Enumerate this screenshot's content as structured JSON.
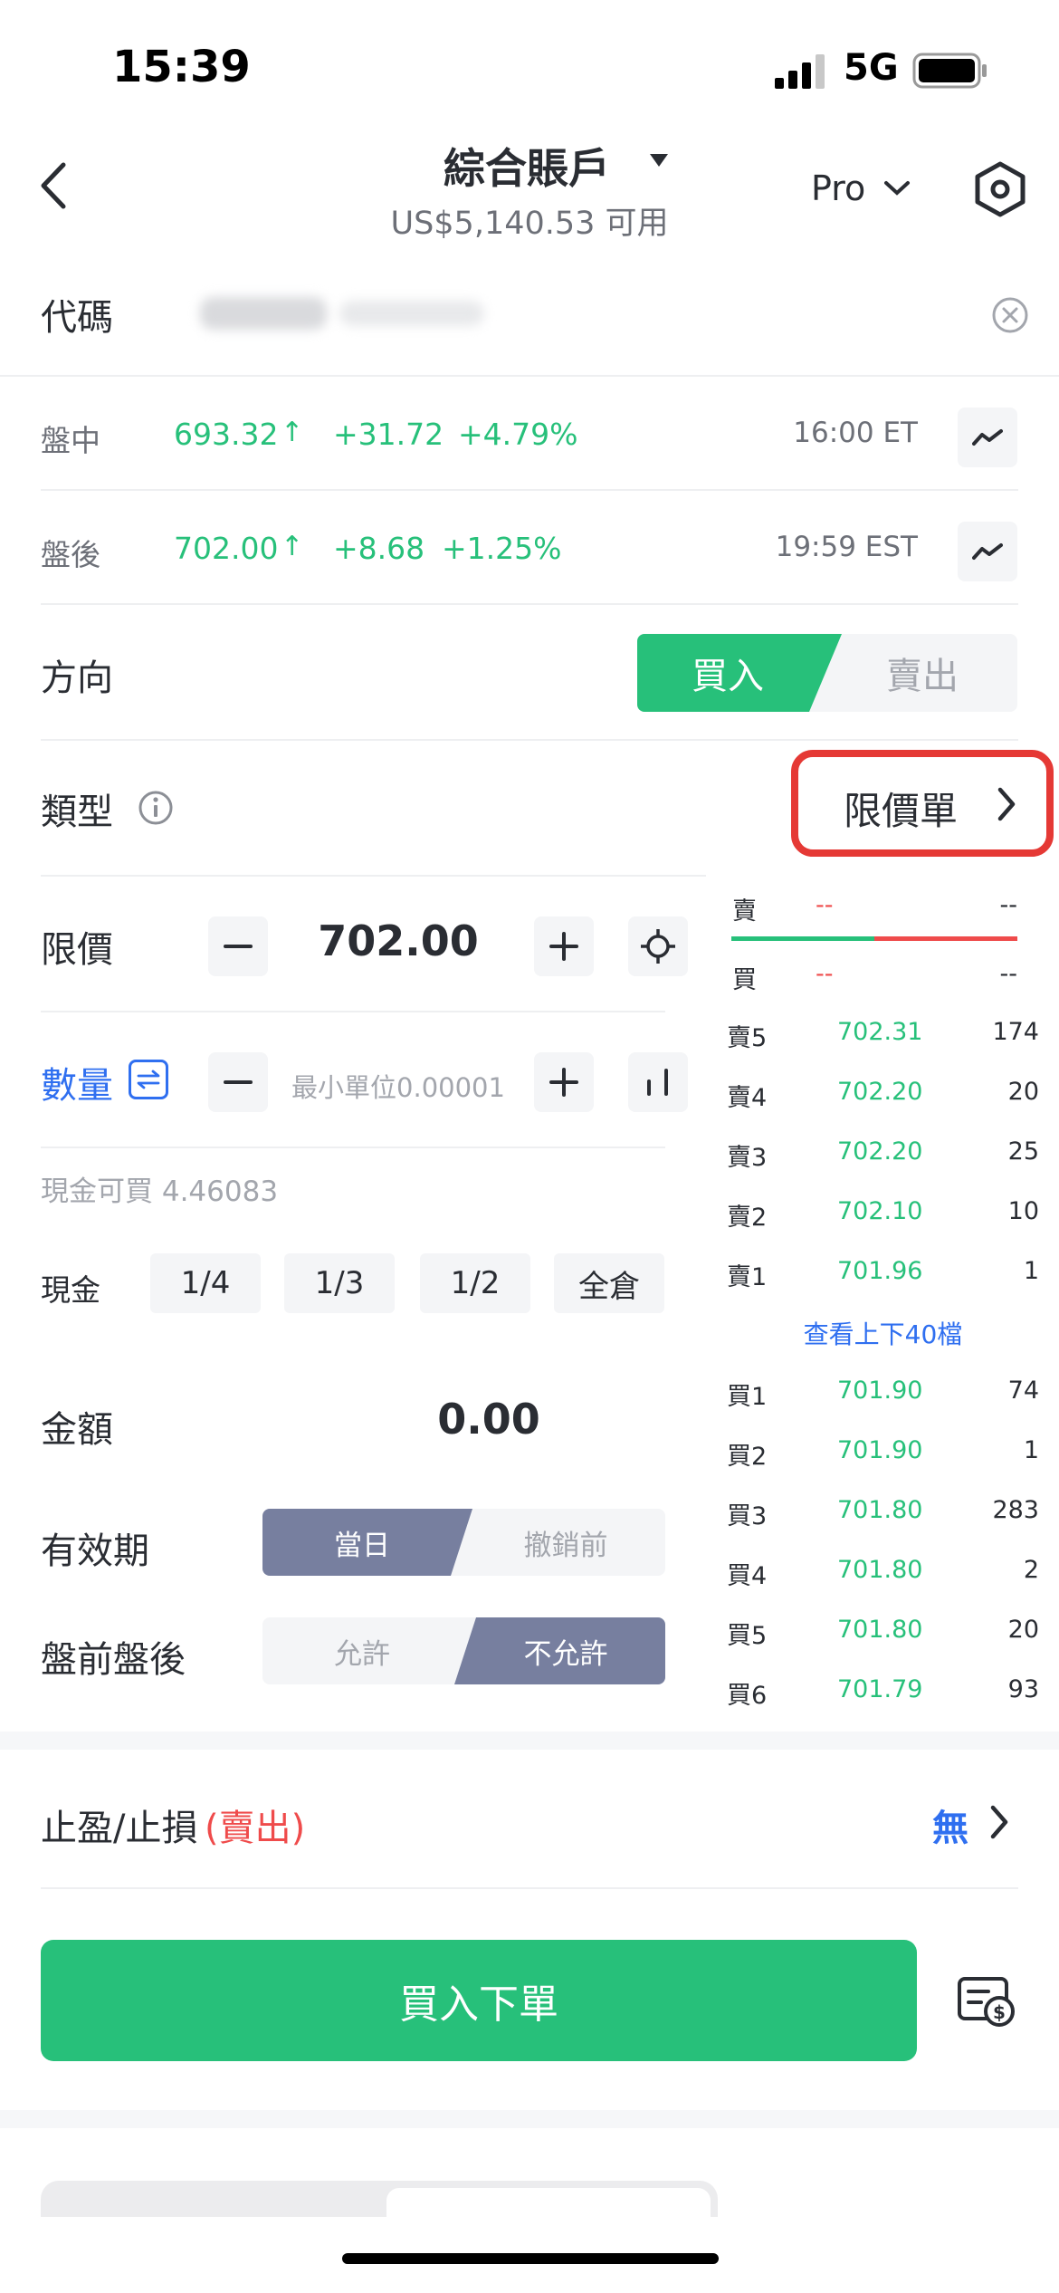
{
  "status_bar": {
    "time": "15:39",
    "network": "5G"
  },
  "header": {
    "title": "綜合賬戶",
    "subtitle": "US$5,140.53 可用",
    "pro_label": "Pro"
  },
  "code_row": {
    "label": "代碼"
  },
  "quotes": [
    {
      "label": "盤中",
      "price": "693.32",
      "arrow": "↑",
      "change": "+31.72",
      "percent": "+4.79%",
      "time": "16:00 ET"
    },
    {
      "label": "盤後",
      "price": "702.00",
      "arrow": "↑",
      "change": "+8.68",
      "percent": "+1.25%",
      "time": "19:59 EST"
    }
  ],
  "direction": {
    "label": "方向",
    "buy": "買入",
    "sell": "賣出"
  },
  "type": {
    "label": "類型",
    "value": "限價單"
  },
  "limit": {
    "label": "限價",
    "value": "702.00"
  },
  "quantity": {
    "label": "數量",
    "placeholder": "最小單位0.00001"
  },
  "cash_available": "現金可買 4.46083",
  "cash_row": {
    "label": "現金",
    "options": [
      "1/4",
      "1/3",
      "1/2",
      "全倉"
    ]
  },
  "amount": {
    "label": "金額",
    "value": "0.00"
  },
  "validity": {
    "label": "有效期",
    "left": "當日",
    "right": "撤銷前"
  },
  "extended": {
    "label": "盤前盤後",
    "left": "允許",
    "right": "不允許"
  },
  "order_book": {
    "sell_header": {
      "label": "賣",
      "price": "--",
      "qty": "--"
    },
    "buy_header": {
      "label": "買",
      "price": "--",
      "qty": "--"
    },
    "asks": [
      {
        "label": "賣5",
        "price": "702.31",
        "qty": "174"
      },
      {
        "label": "賣4",
        "price": "702.20",
        "qty": "20"
      },
      {
        "label": "賣3",
        "price": "702.20",
        "qty": "25"
      },
      {
        "label": "賣2",
        "price": "702.10",
        "qty": "10"
      },
      {
        "label": "賣1",
        "price": "701.96",
        "qty": "1"
      }
    ],
    "view_more": "查看上下40檔",
    "bids": [
      {
        "label": "買1",
        "price": "701.90",
        "qty": "74"
      },
      {
        "label": "買2",
        "price": "701.90",
        "qty": "1"
      },
      {
        "label": "買3",
        "price": "701.80",
        "qty": "283"
      },
      {
        "label": "買4",
        "price": "701.80",
        "qty": "2"
      },
      {
        "label": "買5",
        "price": "701.80",
        "qty": "20"
      },
      {
        "label": "買6",
        "price": "701.79",
        "qty": "93"
      }
    ]
  },
  "stop": {
    "label": "止盈/止損",
    "label_suffix": "(賣出)",
    "value": "無"
  },
  "submit": {
    "label": "買入下單"
  },
  "colors": {
    "green": "#27c07a",
    "red": "#ef4b4b",
    "segment": "#777f9f",
    "highlight": "#e53935",
    "link": "#2f6ff0"
  }
}
